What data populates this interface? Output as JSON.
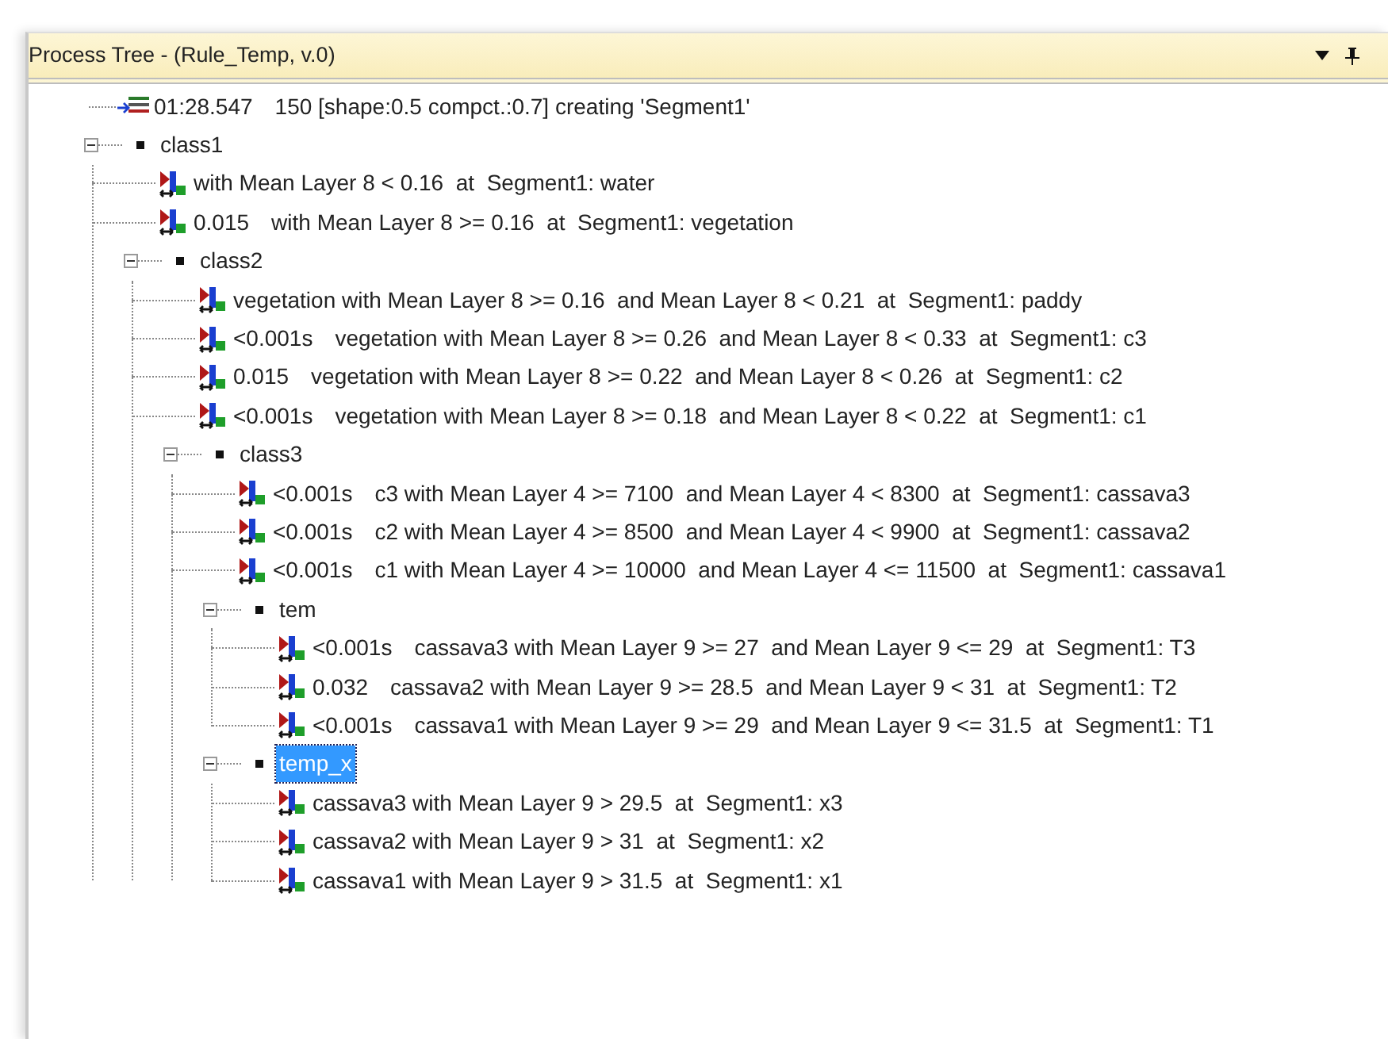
{
  "panel": {
    "title": "Process Tree - (Rule_Temp, v.0)"
  },
  "tree": [
    {
      "kind": "segmentation",
      "time": "01:28.547",
      "text": "150 [shape:0.5 compct.:0.7] creating 'Segment1'"
    },
    {
      "kind": "class",
      "label": "class1",
      "expanded": true,
      "selected": false,
      "children": [
        {
          "kind": "rule",
          "text": "with Mean Layer 8 < 0.16  at  Segment1: water"
        },
        {
          "kind": "rule",
          "time": "0.015",
          "text": "with Mean Layer 8 >= 0.16  at  Segment1: vegetation"
        },
        {
          "kind": "class",
          "label": "class2",
          "expanded": true,
          "selected": false,
          "children": [
            {
              "kind": "rule",
              "text": "vegetation with Mean Layer 8 >= 0.16  and Mean Layer 8 < 0.21  at  Segment1: paddy"
            },
            {
              "kind": "rule",
              "time": "<0.001s",
              "text": "vegetation with Mean Layer 8 >= 0.26  and Mean Layer 8 < 0.33  at  Segment1: c3"
            },
            {
              "kind": "rule",
              "time": "0.015",
              "text": "vegetation with Mean Layer 8 >= 0.22  and Mean Layer 8 < 0.26  at  Segment1: c2"
            },
            {
              "kind": "rule",
              "time": "<0.001s",
              "text": "vegetation with Mean Layer 8 >= 0.18  and Mean Layer 8 < 0.22  at  Segment1: c1"
            },
            {
              "kind": "class",
              "label": "class3",
              "expanded": true,
              "selected": false,
              "children": [
                {
                  "kind": "rule",
                  "time": "<0.001s",
                  "text": "c3 with Mean Layer 4 >= 7100  and Mean Layer 4 < 8300  at  Segment1: cassava3"
                },
                {
                  "kind": "rule",
                  "time": "<0.001s",
                  "text": "c2 with Mean Layer 4 >= 8500  and Mean Layer 4 < 9900  at  Segment1: cassava2"
                },
                {
                  "kind": "rule",
                  "time": "<0.001s",
                  "text": "c1 with Mean Layer 4 >= 10000  and Mean Layer 4 <= 11500  at  Segment1: cassava1"
                },
                {
                  "kind": "class",
                  "label": "tem",
                  "expanded": true,
                  "selected": false,
                  "children": [
                    {
                      "kind": "rule",
                      "time": "<0.001s",
                      "text": "cassava3 with Mean Layer 9 >= 27  and Mean Layer 9 <= 29  at  Segment1: T3"
                    },
                    {
                      "kind": "rule",
                      "time": "0.032",
                      "text": "cassava2 with Mean Layer 9 >= 28.5  and Mean Layer 9 < 31  at  Segment1: T2"
                    },
                    {
                      "kind": "rule",
                      "time": "<0.001s",
                      "text": "cassava1 with Mean Layer 9 >= 29  and Mean Layer 9 <= 31.5  at  Segment1: T1"
                    }
                  ]
                },
                {
                  "kind": "class",
                  "label": "temp_x",
                  "expanded": true,
                  "selected": true,
                  "children": [
                    {
                      "kind": "rule",
                      "text": "cassava3 with Mean Layer 9 > 29.5  at  Segment1: x3"
                    },
                    {
                      "kind": "rule",
                      "text": "cassava2 with Mean Layer 9 > 31  at  Segment1: x2"
                    },
                    {
                      "kind": "rule",
                      "text": "cassava1 with Mean Layer 9 > 31.5  at  Segment1: x1"
                    }
                  ]
                }
              ]
            }
          ]
        }
      ]
    }
  ]
}
